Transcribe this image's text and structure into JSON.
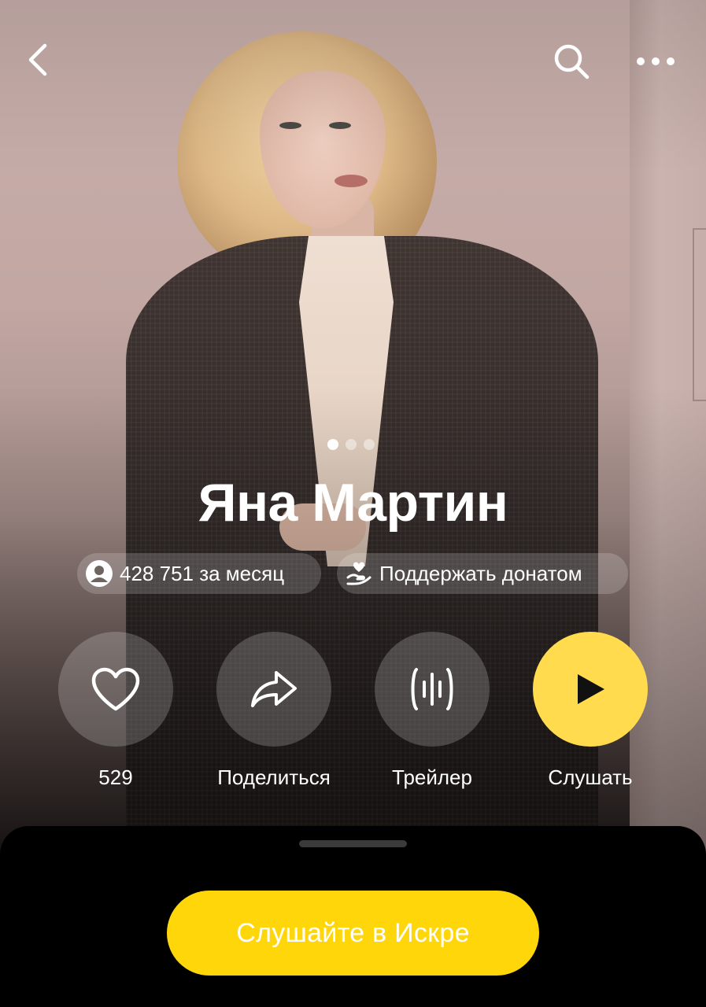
{
  "header": {
    "back_icon": "chevron-left-icon",
    "search_icon": "search-icon",
    "more_icon": "more-horizontal-icon"
  },
  "carousel": {
    "count": 3,
    "active": 0
  },
  "artist": {
    "name": "Яна Мартин",
    "listeners": "428 751 за месяц",
    "listeners_icon": "person-circle-icon",
    "donate_label": "Поддержать донатом",
    "donate_icon": "heart-hand-icon"
  },
  "actions": [
    {
      "icon": "heart-icon",
      "label": "529"
    },
    {
      "icon": "share-icon",
      "label": "Поделиться"
    },
    {
      "icon": "waveform-icon",
      "label": "Трейлер"
    },
    {
      "icon": "play-icon",
      "label": "Слушать"
    }
  ],
  "sheet": {
    "cta_label": "Слушайте в Искре"
  },
  "colors": {
    "accent": "#ffdb4d",
    "cta": "#ffd60a",
    "sheet_bg": "#000000"
  }
}
